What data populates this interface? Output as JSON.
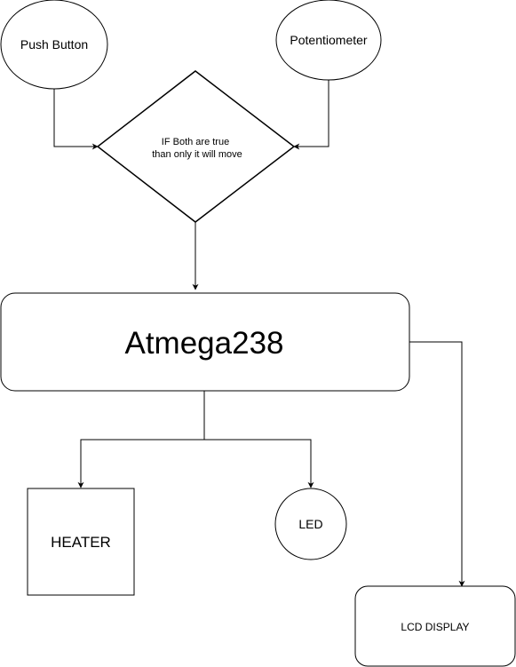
{
  "diagram": {
    "nodes": {
      "push_button": {
        "label": "Push Button",
        "shape": "ellipse"
      },
      "potentiometer": {
        "label": "Potentiometer",
        "shape": "ellipse"
      },
      "decision": {
        "line1": "IF Both are true",
        "line2": "than only it will move",
        "shape": "diamond"
      },
      "mcu": {
        "label": "Atmega238",
        "shape": "rounded-rectangle"
      },
      "heater": {
        "label": "HEATER",
        "shape": "rectangle"
      },
      "led": {
        "label": "LED",
        "shape": "ellipse"
      },
      "lcd": {
        "label": "LCD DISPLAY",
        "shape": "rounded-rectangle"
      }
    },
    "edges": [
      {
        "from": "push_button",
        "to": "decision"
      },
      {
        "from": "potentiometer",
        "to": "decision"
      },
      {
        "from": "decision",
        "to": "mcu"
      },
      {
        "from": "mcu",
        "to": "heater"
      },
      {
        "from": "mcu",
        "to": "led"
      },
      {
        "from": "mcu",
        "to": "lcd"
      }
    ],
    "colors": {
      "stroke": "#000000",
      "fill": "#ffffff",
      "text": "#000000"
    }
  }
}
